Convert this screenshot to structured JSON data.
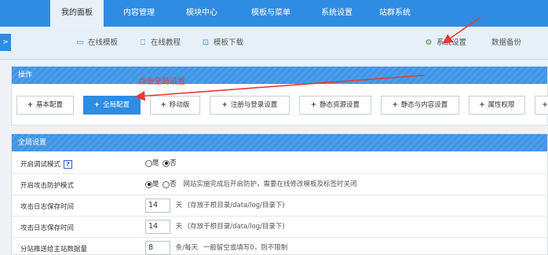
{
  "topnav": {
    "items": [
      {
        "label": "我的面板",
        "active": true
      },
      {
        "label": "内容管理"
      },
      {
        "label": "模块中心"
      },
      {
        "label": "模板与菜单"
      },
      {
        "label": "系统设置"
      },
      {
        "label": "站群系统"
      }
    ]
  },
  "subbar": {
    "toggle": ">",
    "links": {
      "online_templates": "在线模板",
      "online_tutorials": "在线教程",
      "template_download": "模板下载",
      "system_settings": "系统设置",
      "data_backup": "数据备份"
    }
  },
  "operations": {
    "header": "操作",
    "plus": "+",
    "buttons": [
      {
        "label": "基本配置"
      },
      {
        "label": "全局配置",
        "active": true
      },
      {
        "label": "移动版"
      },
      {
        "label": "注册与登录设置"
      },
      {
        "label": "静态资源设置"
      },
      {
        "label": "静态与内容设置"
      },
      {
        "label": "属性权限"
      }
    ]
  },
  "annotation": {
    "text": "点击全局设置",
    "color": "#e63a3a"
  },
  "global": {
    "header": "全局设置",
    "radio_yes": "是",
    "radio_no": "否",
    "rows": [
      {
        "label": "开启调试模式",
        "help": "?",
        "selected": "no"
      },
      {
        "label": "开启攻击防护模式",
        "selected": "yes",
        "hint": "网站实施完成后开启防护，需要在线修改模板及标签时关闭"
      },
      {
        "label": "攻击日志保存时间",
        "value": "14",
        "unit": "天",
        "hint": "(存放于根目录/data/log/目录下)"
      },
      {
        "label": "攻击日志保存时间",
        "value": "14",
        "unit": "天",
        "hint": "(存放于根目录/data/log/目录下)"
      },
      {
        "label": "分站推送给主站数据量",
        "value": "8",
        "unit": "条/每天",
        "hint": "一般留空或填写0，则不限制"
      }
    ]
  },
  "colors": {
    "primary": "#2f8ce3",
    "annotation": "#e63a3a"
  }
}
